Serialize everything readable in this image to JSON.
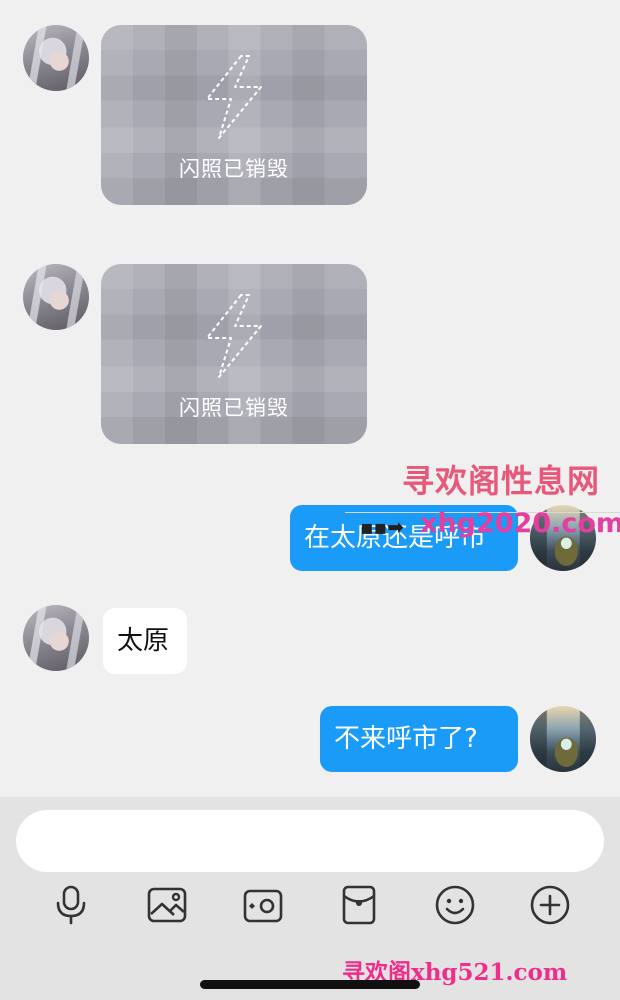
{
  "messages": {
    "flash1": {
      "label": "闪照已销毁"
    },
    "flash2": {
      "label": "闪照已销毁"
    },
    "msg1": {
      "text": "在太原还是呼市"
    },
    "msg2": {
      "text": "太原"
    },
    "msg3": {
      "text": "不来呼市了?"
    }
  },
  "watermark": {
    "line1": "寻欢阁性息网",
    "line2": "xhg2020.com",
    "footer": "寻欢阁xhg521.com"
  },
  "toolbar": {
    "icons": [
      "microphone-icon",
      "image-icon",
      "camera-icon",
      "red-packet-icon",
      "emoji-icon",
      "plus-icon"
    ]
  },
  "colors": {
    "sent_bubble": "#1b9bf8",
    "received_bubble": "#ffffff",
    "chat_bg": "#f0f0f0",
    "input_bar": "#e3e3e3"
  }
}
